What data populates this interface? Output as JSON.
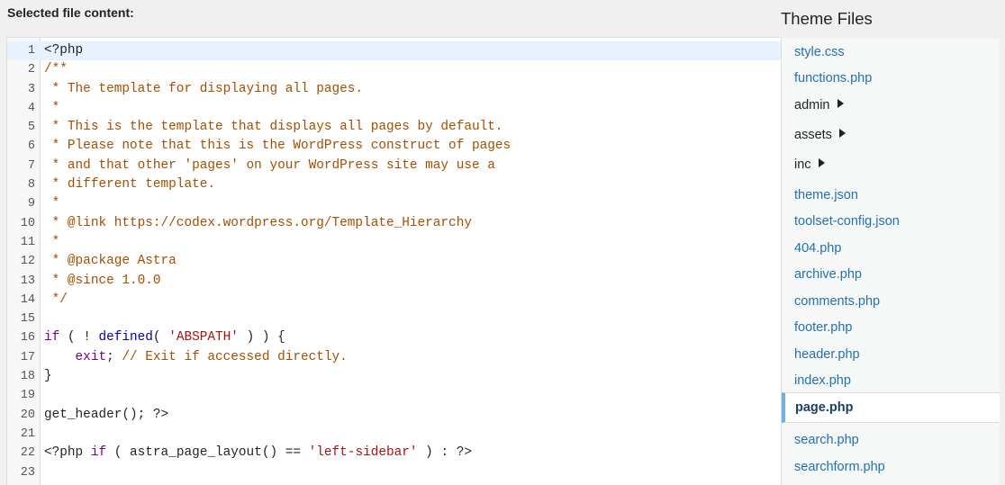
{
  "editor": {
    "label": "Selected file content:",
    "lines": [
      [
        {
          "t": "<?php",
          "c": "plain"
        }
      ],
      [
        {
          "t": "/**",
          "c": "comment"
        }
      ],
      [
        {
          "t": " * The template for displaying all pages.",
          "c": "comment"
        }
      ],
      [
        {
          "t": " *",
          "c": "comment"
        }
      ],
      [
        {
          "t": " * This is the template that displays all pages by default.",
          "c": "comment"
        }
      ],
      [
        {
          "t": " * Please note that this is the WordPress construct of pages",
          "c": "comment"
        }
      ],
      [
        {
          "t": " * and that other 'pages' on your WordPress site may use a",
          "c": "comment"
        }
      ],
      [
        {
          "t": " * different template.",
          "c": "comment"
        }
      ],
      [
        {
          "t": " *",
          "c": "comment"
        }
      ],
      [
        {
          "t": " * @link https://codex.wordpress.org/Template_Hierarchy",
          "c": "comment"
        }
      ],
      [
        {
          "t": " *",
          "c": "comment"
        }
      ],
      [
        {
          "t": " * @package Astra",
          "c": "comment"
        }
      ],
      [
        {
          "t": " * @since 1.0.0",
          "c": "comment"
        }
      ],
      [
        {
          "t": " */",
          "c": "comment"
        }
      ],
      [],
      [
        {
          "t": "if",
          "c": "keyword"
        },
        {
          "t": " ( ! ",
          "c": "plain"
        },
        {
          "t": "defined",
          "c": "builtin"
        },
        {
          "t": "( ",
          "c": "plain"
        },
        {
          "t": "'ABSPATH'",
          "c": "string"
        },
        {
          "t": " ) ) {",
          "c": "plain"
        }
      ],
      [
        {
          "t": "    ",
          "c": "plain"
        },
        {
          "t": "exit",
          "c": "keyword"
        },
        {
          "t": "; ",
          "c": "plain"
        },
        {
          "t": "// Exit if accessed directly.",
          "c": "comment"
        }
      ],
      [
        {
          "t": "}",
          "c": "plain"
        }
      ],
      [],
      [
        {
          "t": "get_header(); ?>",
          "c": "plain"
        }
      ],
      [],
      [
        {
          "t": "<?php ",
          "c": "plain"
        },
        {
          "t": "if",
          "c": "keyword"
        },
        {
          "t": " ( astra_page_layout() == ",
          "c": "plain"
        },
        {
          "t": "'left-sidebar'",
          "c": "string"
        },
        {
          "t": " ) : ?>",
          "c": "plain"
        }
      ],
      []
    ]
  },
  "sidebar": {
    "title": "Theme Files",
    "items": [
      {
        "label": "style.css",
        "type": "file"
      },
      {
        "label": "functions.php",
        "type": "file"
      },
      {
        "label": "admin",
        "type": "folder"
      },
      {
        "label": "assets",
        "type": "folder"
      },
      {
        "label": "inc",
        "type": "folder"
      },
      {
        "label": "theme.json",
        "type": "file"
      },
      {
        "label": "toolset-config.json",
        "type": "file"
      },
      {
        "label": "404.php",
        "type": "file"
      },
      {
        "label": "archive.php",
        "type": "file"
      },
      {
        "label": "comments.php",
        "type": "file"
      },
      {
        "label": "footer.php",
        "type": "file"
      },
      {
        "label": "header.php",
        "type": "file"
      },
      {
        "label": "index.php",
        "type": "file"
      },
      {
        "label": "page.php",
        "type": "file",
        "current": true
      },
      {
        "label": "search.php",
        "type": "file"
      },
      {
        "label": "searchform.php",
        "type": "file"
      }
    ]
  },
  "colors": {
    "link": "#2271b1",
    "current_border": "#72aee6",
    "comment": "#a54e00",
    "keyword": "#770088",
    "builtin": "#0000a8",
    "string": "#aa1111"
  }
}
